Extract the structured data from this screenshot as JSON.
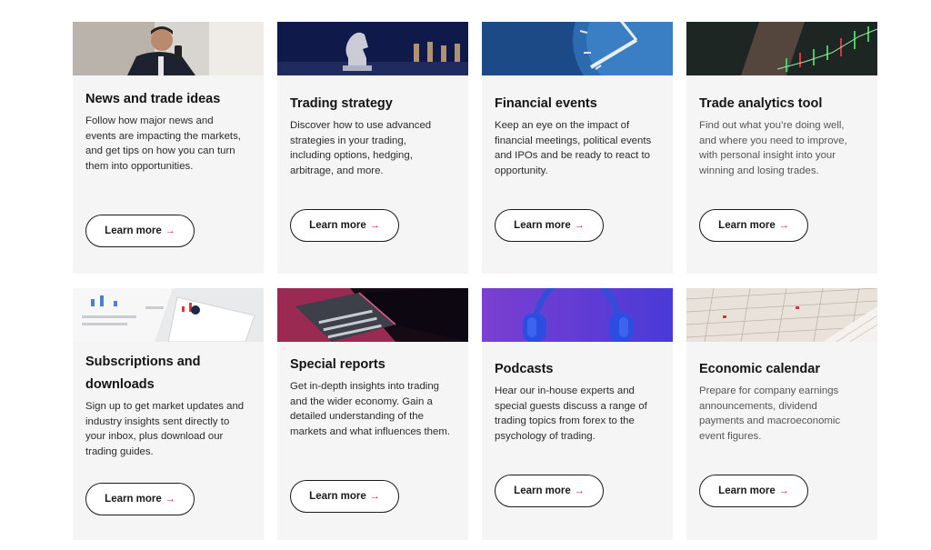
{
  "cards": [
    {
      "title": "News and trade ideas",
      "desc": "Follow how major news and events are impacting the markets, and get tips on how you can turn them into opportunities.",
      "button": "Learn more",
      "arrow": "→"
    },
    {
      "title": "Trading strategy",
      "desc": "Discover how to use advanced strategies in your trading, including options, hedging, arbitrage, and more.",
      "button": "Learn more",
      "arrow": "→"
    },
    {
      "title": "Financial events",
      "desc": "Keep an eye on the impact of financial meetings, political events and IPOs and be ready to react to opportunity.",
      "button": "Learn more",
      "arrow": "→"
    },
    {
      "title": "Trade analytics tool",
      "desc": "Find out what you’re doing well, and where you need to improve, with personal insight into your winning and losing trades.",
      "button": "Learn more",
      "arrow": "→"
    },
    {
      "title": "Subscriptions and downloads",
      "desc": "Sign up to get market updates and industry insights sent directly to your inbox, plus download our trading guides.",
      "button": "Learn more",
      "arrow": "→"
    },
    {
      "title": "Special reports",
      "desc": "Get in-depth insights into trading and the wider economy. Gain a detailed understanding of the markets and what influences them.",
      "button": "Learn more",
      "arrow": "→"
    },
    {
      "title": "Podcasts",
      "desc": "Hear our in-house experts and special guests discuss a range of trading topics from forex to the psychology of trading.",
      "button": "Learn more",
      "arrow": "→"
    },
    {
      "title": "Economic calendar",
      "desc": "Prepare for company earnings announcements, dividend payments and macroeconomic event figures.",
      "button": "Learn more",
      "arrow": "→"
    }
  ],
  "colors": {
    "card_bg": "#f5f5f5",
    "accent_arrow": "#e01e26",
    "text": "#1a1a1a"
  }
}
